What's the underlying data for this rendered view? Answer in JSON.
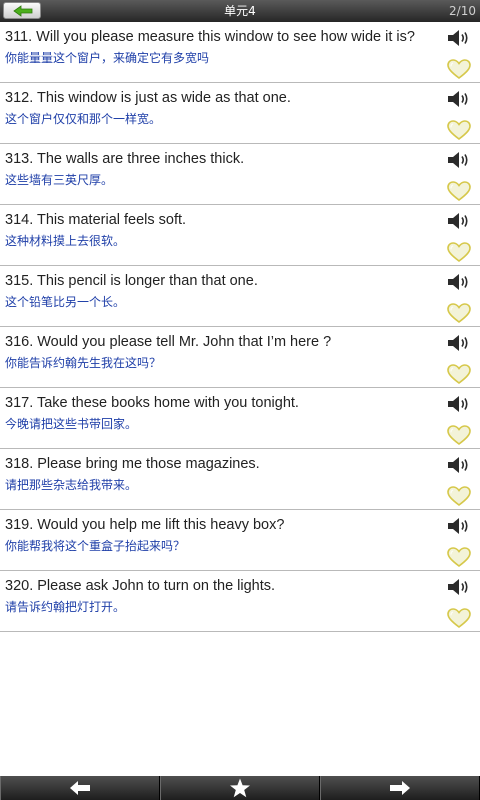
{
  "header": {
    "back_icon": "back-arrow-icon",
    "title": "单元4",
    "page_indicator": "2/10"
  },
  "colors": {
    "english_text": "#222222",
    "chinese_text": "#1f3fa8",
    "heart_fill": "#f3f3d8",
    "heart_stroke": "#d6c84a",
    "header_bg": "#3a3a3a",
    "back_arrow": "#4caf1c"
  },
  "sentences": [
    {
      "english": "311. Will you please measure this window to see how wide it is?",
      "chinese": "你能量量这个窗户，来确定它有多宽吗",
      "audio_icon": "speaker-icon",
      "favorite_icon": "heart-icon"
    },
    {
      "english": "312. This window is just as wide as that one.",
      "chinese": "这个窗户仅仅和那个一样宽。",
      "audio_icon": "speaker-icon",
      "favorite_icon": "heart-icon"
    },
    {
      "english": "313. The walls are three inches thick.",
      "chinese": "这些墙有三英尺厚。",
      "audio_icon": "speaker-icon",
      "favorite_icon": "heart-icon"
    },
    {
      "english": "314. This material feels soft.",
      "chinese": "这种材料摸上去很软。",
      "audio_icon": "speaker-icon",
      "favorite_icon": "heart-icon"
    },
    {
      "english": "315. This pencil is longer than that one.",
      "chinese": "这个铅笔比另一个长。",
      "audio_icon": "speaker-icon",
      "favorite_icon": "heart-icon"
    },
    {
      "english": "316. Would you please tell Mr. John that I’m here ?",
      "chinese": "你能告诉约翰先生我在这吗？",
      "audio_icon": "speaker-icon",
      "favorite_icon": "heart-icon"
    },
    {
      "english": "317. Take these books home with you tonight.",
      "chinese": "今晚请把这些书带回家。",
      "audio_icon": "speaker-icon",
      "favorite_icon": "heart-icon"
    },
    {
      "english": "318. Please bring me those magazines.",
      "chinese": "请把那些杂志给我带来。",
      "audio_icon": "speaker-icon",
      "favorite_icon": "heart-icon"
    },
    {
      "english": "319. Would you help me lift this heavy box?",
      "chinese": "你能帮我将这个重盒子抬起来吗？",
      "audio_icon": "speaker-icon",
      "favorite_icon": "heart-icon"
    },
    {
      "english": "320. Please ask John to turn on the lights.",
      "chinese": "请告诉约翰把灯打开。",
      "audio_icon": "speaker-icon",
      "favorite_icon": "heart-icon"
    }
  ],
  "bottom_nav": {
    "previous_icon": "left-arrow-icon",
    "favorites_icon": "star-icon",
    "next_icon": "right-arrow-icon"
  }
}
